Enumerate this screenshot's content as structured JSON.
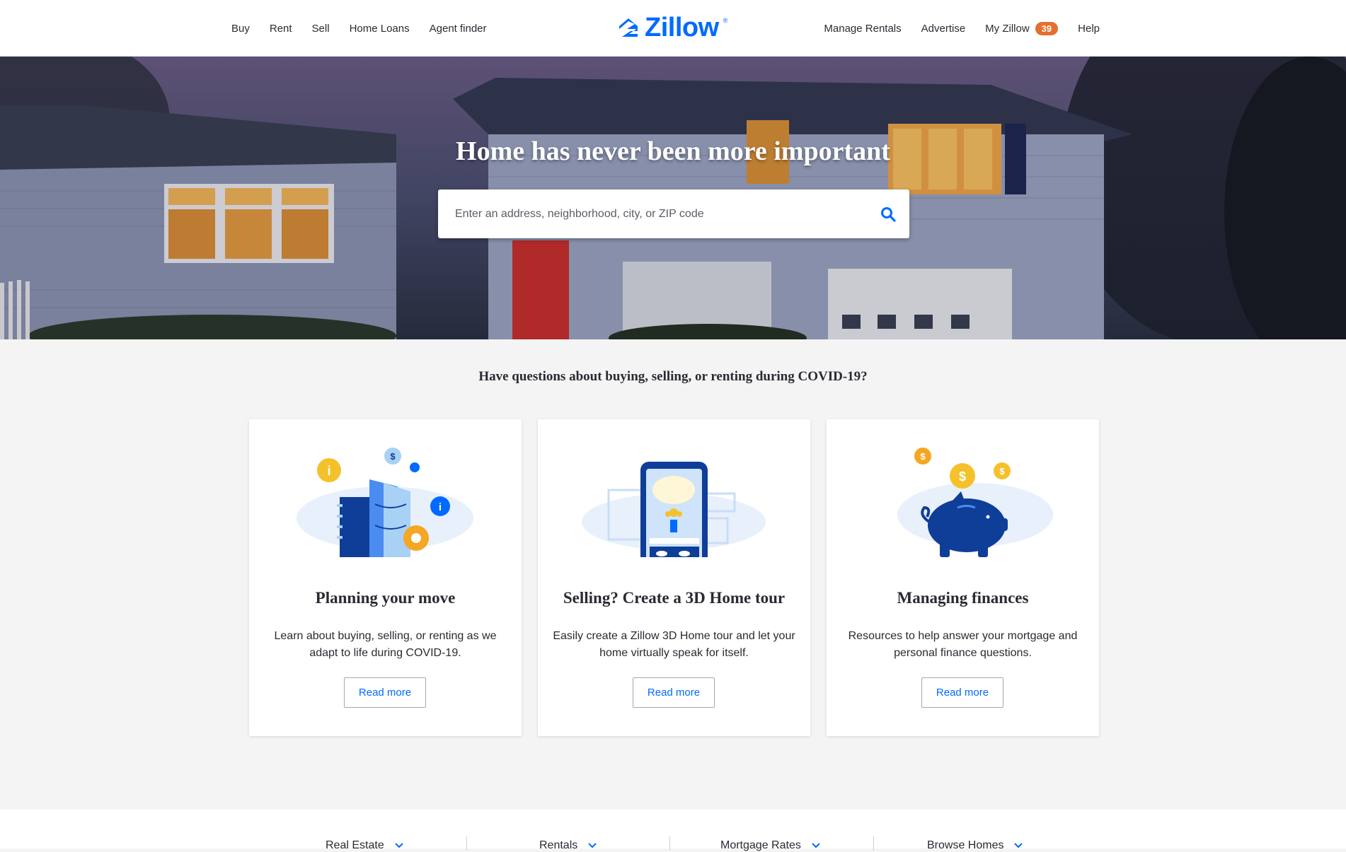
{
  "header": {
    "nav_left": [
      "Buy",
      "Rent",
      "Sell",
      "Home Loans",
      "Agent finder"
    ],
    "logo_text": "Zillow",
    "logo_reg": "®",
    "nav_right": {
      "manage_rentals": "Manage Rentals",
      "advertise": "Advertise",
      "my_zillow": "My Zillow",
      "my_zillow_count": "39",
      "help": "Help"
    }
  },
  "hero": {
    "title": "Home has never been more important",
    "search_placeholder": "Enter an address, neighborhood, city, or ZIP code",
    "search_icon": "search-icon"
  },
  "covid": {
    "heading": "Have questions about buying, selling, or renting during COVID-19?",
    "cards": [
      {
        "title": "Planning your move",
        "description": "Learn about buying, selling, or renting as we adapt to life during COVID-19.",
        "button": "Read more",
        "icon": "planning-illustration-icon"
      },
      {
        "title": "Selling? Create a 3D Home tour",
        "description": "Easily create a Zillow 3D Home tour and let your home virtually speak for itself.",
        "button": "Read more",
        "icon": "3d-tour-phone-illustration-icon"
      },
      {
        "title": "Managing finances",
        "description": "Resources to help answer your mortgage and personal finance questions.",
        "button": "Read more",
        "icon": "piggy-bank-illustration-icon"
      }
    ]
  },
  "footer": {
    "tabs": [
      "Real Estate",
      "Rentals",
      "Mortgage Rates",
      "Browse Homes"
    ]
  },
  "colors": {
    "brand": "#006aff",
    "badge": "#e66e2e",
    "text": "#2a2a33",
    "illus_navy": "#0f3e99",
    "illus_gold": "#f5b800"
  }
}
